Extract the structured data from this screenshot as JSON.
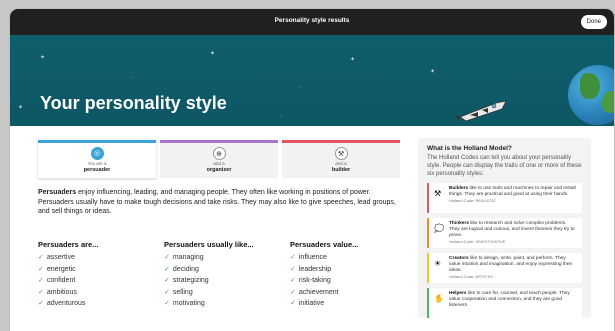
{
  "window": {
    "title": "Personality style results",
    "done_label": "Done"
  },
  "hero": {
    "heading": "Your personality style"
  },
  "cards": [
    {
      "sub": "You are a",
      "name": "persuader",
      "color": "#3ba3d6",
      "icon": "target-icon",
      "active": true
    },
    {
      "sub": "and a",
      "name": "organizer",
      "color": "#a974c9",
      "icon": "organizer-icon",
      "active": false
    },
    {
      "sub": "and a",
      "name": "builder",
      "color": "#e05560",
      "icon": "hammer-icon",
      "active": false
    }
  ],
  "intro": {
    "lead": "Persuaders",
    "text": " enjoy influencing, leading, and managing people. They often like working in positions of power. Persuaders usually have to make tough decisions and take risks. They may also like to give speeches, lead groups, and sell things or ideas."
  },
  "columns": [
    {
      "heading": "Persuaders are...",
      "items": [
        "assertive",
        "energetic",
        "confident",
        "ambitious",
        "adventurous"
      ]
    },
    {
      "heading": "Persuaders usually like...",
      "items": [
        "managing",
        "deciding",
        "strategizing",
        "selling",
        "motivating"
      ]
    },
    {
      "heading": "Persuaders value...",
      "items": [
        "influence",
        "leadership",
        "risk-taking",
        "achievement",
        "initiative"
      ]
    }
  ],
  "sidebar": {
    "heading": "What is the Holland Model?",
    "description": "The Holland Codes can tell you about your personality style. People can display the traits of one or more of these six personality styles:",
    "types": [
      {
        "name": "Builders",
        "text": " like to use tools and machines to repair and install things. They are practical and good at using their hands.",
        "code": "Holland Code: REALISTIC",
        "color": "#e05560",
        "icon": "hammer-icon"
      },
      {
        "name": "Thinkers",
        "text": " like to research and solve complex problems. They are logical and curious, and invent theories they try to prove.",
        "code": "Holland Code: INVESTIGATIVE",
        "color": "#f08a2a",
        "icon": "thought-bubble-icon"
      },
      {
        "name": "Creators",
        "text": " like to design, write, paint, and perform. They value intuition and imagination, and enjoy expressing their ideas.",
        "code": "Holland Code: ARTISTIC",
        "color": "#f2c230",
        "icon": "lightbulb-icon"
      },
      {
        "name": "Helpers",
        "text": " like to care for, counsel, and teach people. They value cooperation and connection, and they are good listeners.",
        "code": "",
        "color": "#4fb36a",
        "icon": "helping-hands-icon"
      }
    ]
  }
}
